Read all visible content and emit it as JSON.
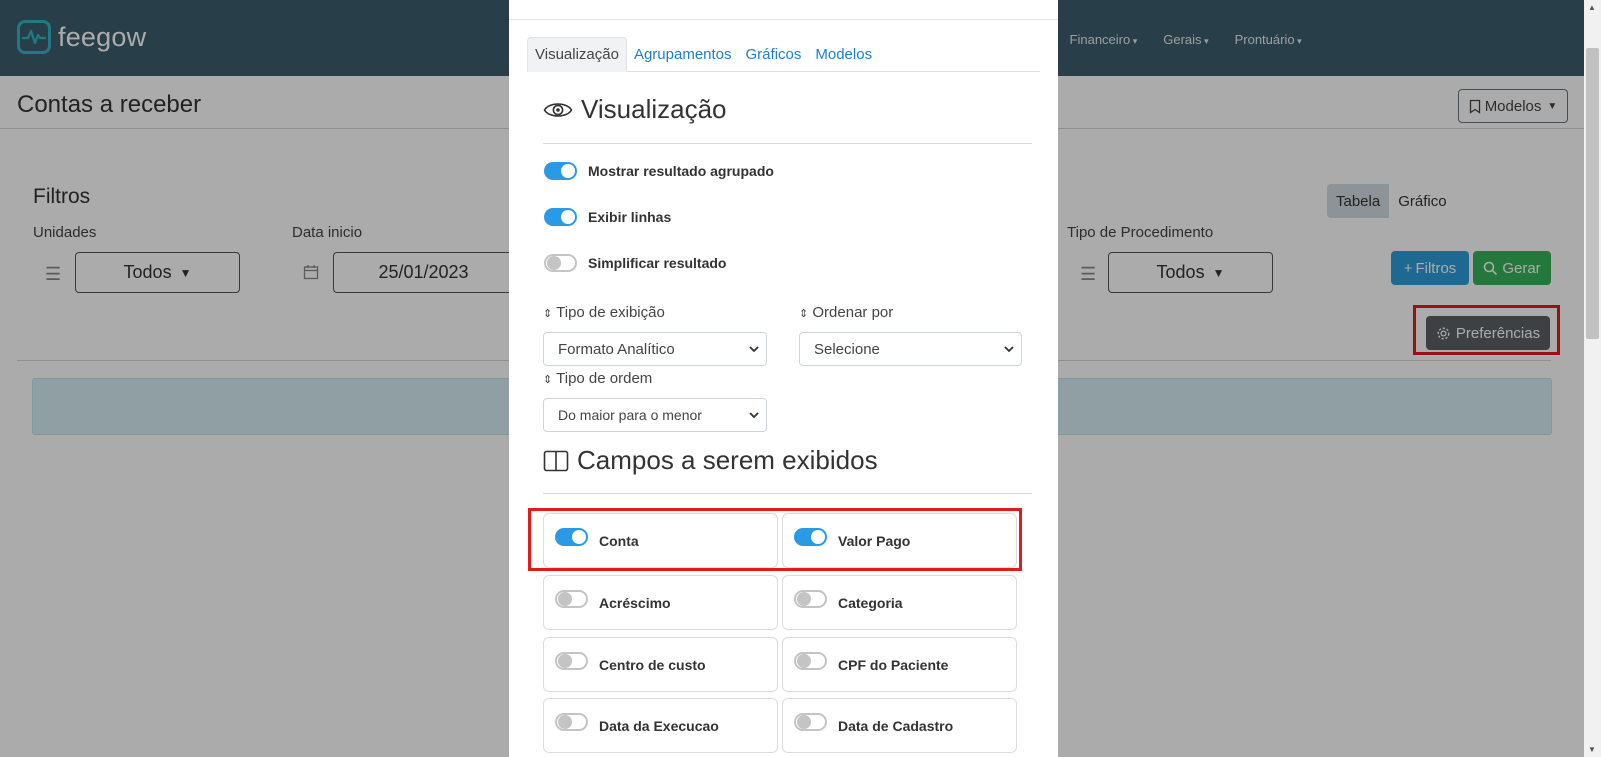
{
  "app": {
    "logo_text": "feegow"
  },
  "topnav": {
    "items": [
      "Financeiro",
      "Gerais",
      "Prontuário"
    ]
  },
  "page": {
    "title": "Contas a receber",
    "models_button": "Modelos"
  },
  "filters": {
    "title": "Filtros",
    "unidades": {
      "label": "Unidades",
      "value": "Todos"
    },
    "data_inicio": {
      "label": "Data inicio",
      "value": "25/01/2023"
    },
    "tipo_procedimento": {
      "label": "Tipo de Procedimento",
      "value": "Todos"
    },
    "view_toggle": {
      "tabela": "Tabela",
      "grafico": "Gráfico"
    },
    "buttons": {
      "filtros": "Filtros",
      "gerar": "Gerar",
      "preferencias": "Preferências"
    }
  },
  "modal": {
    "tabs": [
      "Visualização",
      "Agrupamentos",
      "Gráficos",
      "Modelos"
    ],
    "section1_title": "Visualização",
    "switches": [
      {
        "label": "Mostrar resultado agrupado",
        "on": true
      },
      {
        "label": "Exibir linhas",
        "on": true
      },
      {
        "label": "Simplificar resultado",
        "on": false
      }
    ],
    "tipo_exibicao": {
      "label": "Tipo de exibição",
      "value": "Formato Analítico"
    },
    "ordenar_por": {
      "label": "Ordenar por",
      "value": "Selecione"
    },
    "tipo_ordem": {
      "label": "Tipo de ordem",
      "value": "Do maior para o menor"
    },
    "section2_title": "Campos a serem exibidos",
    "fields": [
      {
        "label": "Conta",
        "on": true
      },
      {
        "label": "Valor Pago",
        "on": true
      },
      {
        "label": "Acréscimo",
        "on": false
      },
      {
        "label": "Categoria",
        "on": false
      },
      {
        "label": "Centro de custo",
        "on": false
      },
      {
        "label": "CPF do Paciente",
        "on": false
      },
      {
        "label": "Data da Execucao",
        "on": false
      },
      {
        "label": "Data de Cadastro",
        "on": false
      }
    ]
  },
  "colors": {
    "topbar": "#3c5e6e",
    "accent_blue": "#2b9ae6",
    "highlight_red": "#e21c1c",
    "btn_green": "#38b45a",
    "btn_grey": "#5d6266"
  }
}
